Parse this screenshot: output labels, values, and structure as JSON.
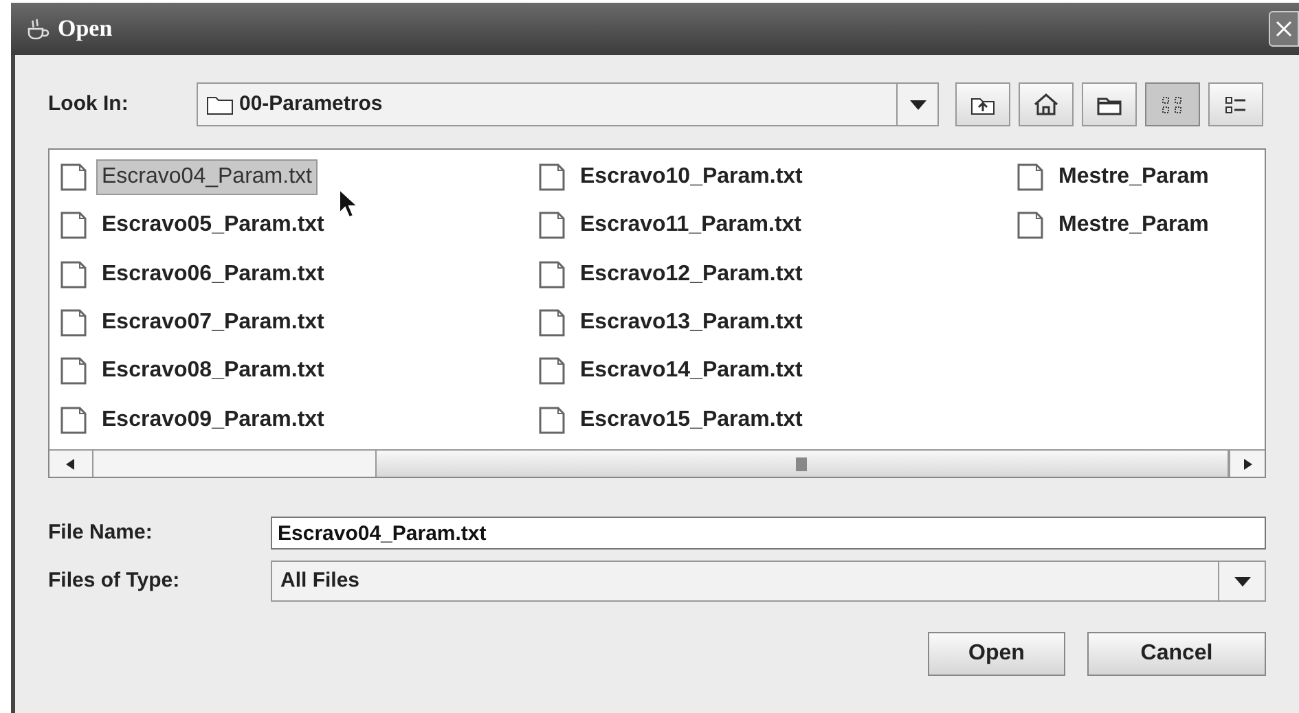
{
  "window": {
    "title": "Open"
  },
  "look_in": {
    "label": "Look In:",
    "value": "00-Parametros"
  },
  "toolbar": [
    {
      "kind": "up",
      "selected": false
    },
    {
      "kind": "home",
      "selected": false
    },
    {
      "kind": "newfolder",
      "selected": false
    },
    {
      "kind": "list",
      "selected": true
    },
    {
      "kind": "details",
      "selected": false
    }
  ],
  "files": [
    {
      "name": "Escravo04_Param.txt",
      "selected": true
    },
    {
      "name": "Escravo05_Param.txt",
      "selected": false
    },
    {
      "name": "Escravo06_Param.txt",
      "selected": false
    },
    {
      "name": "Escravo07_Param.txt",
      "selected": false
    },
    {
      "name": "Escravo08_Param.txt",
      "selected": false
    },
    {
      "name": "Escravo09_Param.txt",
      "selected": false
    },
    {
      "name": "Escravo10_Param.txt",
      "selected": false
    },
    {
      "name": "Escravo11_Param.txt",
      "selected": false
    },
    {
      "name": "Escravo12_Param.txt",
      "selected": false
    },
    {
      "name": "Escravo13_Param.txt",
      "selected": false
    },
    {
      "name": "Escravo14_Param.txt",
      "selected": false
    },
    {
      "name": "Escravo15_Param.txt",
      "selected": false
    },
    {
      "name": "Mestre_Param",
      "selected": false
    },
    {
      "name": "Mestre_Param",
      "selected": false
    }
  ],
  "file_name": {
    "label": "File Name:",
    "value": "Escravo04_Param.txt"
  },
  "file_type": {
    "label": "Files of Type:",
    "value": "All Files"
  },
  "buttons": [
    "Open",
    "Cancel"
  ]
}
